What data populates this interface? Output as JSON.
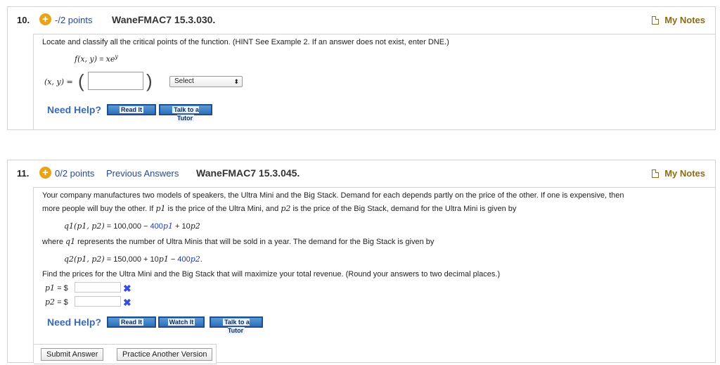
{
  "q10": {
    "number": "10.",
    "points": "-/2 points",
    "id": "WaneFMAC7 15.3.030.",
    "my_notes": "My Notes",
    "prompt": "Locate and classify all the critical points of the function. (HINT See Example 2. If an answer does not exist, enter DNE.)",
    "function_lhs": "f(x, y)",
    "function_eq": " = ",
    "function_rhs": "xe",
    "function_exp": "y",
    "answer_label": "(x, y) = ",
    "select_value": "Select",
    "need_help": "Need Help?",
    "read_it": "Read It",
    "talk_to_tutor": "Talk to a Tutor"
  },
  "q11": {
    "number": "11.",
    "points": "0/2 points",
    "previous_answers": "Previous Answers",
    "id": "WaneFMAC7 15.3.045.",
    "my_notes": "My Notes",
    "para1_line1": "Your company manufactures two models of speakers, the Ultra Mini and the Big Stack. Demand for each depends partly on the price of the other. If one is expensive, then",
    "para1_line2_a": "more people will buy the other. If ",
    "para1_line2_b": " is the price of the Ultra Mini, and ",
    "para1_line2_c": " is the price of the Big Stack, demand for the Ultra Mini is given by",
    "p1": "p1",
    "p2": "p2",
    "eq1_lhs": "q1(p1, p2)",
    "eq1_a": " = 100,000 − ",
    "eq1_b": "400",
    "eq1_c": "p1",
    "eq1_d": " + 10",
    "eq1_e": "p2",
    "where_a": "where ",
    "where_q1": "q1",
    "where_b": " represents the number of Ultra Minis that will be sold in a year. The demand for the Big Stack is given by",
    "eq2_lhs": "q2(p1, p2)",
    "eq2_a": " = 150,000 + 10",
    "eq2_b": "p1",
    "eq2_c": " − ",
    "eq2_d": "400",
    "eq2_e": "p2",
    "eq2_f": ".",
    "find_prompt": "Find the prices for the Ultra Mini and the Big Stack that will maximize your total revenue. (Round your answers to two decimal places.)",
    "p1_label": "p1",
    "p2_label": "p2",
    "equals_dollar": "= $",
    "wrong_mark": "✖",
    "need_help": "Need Help?",
    "read_it": "Read It",
    "watch_it": "Watch It",
    "talk_to_tutor": "Talk to a Tutor",
    "submit_answer": "Submit Answer",
    "practice_another": "Practice Another Version"
  }
}
